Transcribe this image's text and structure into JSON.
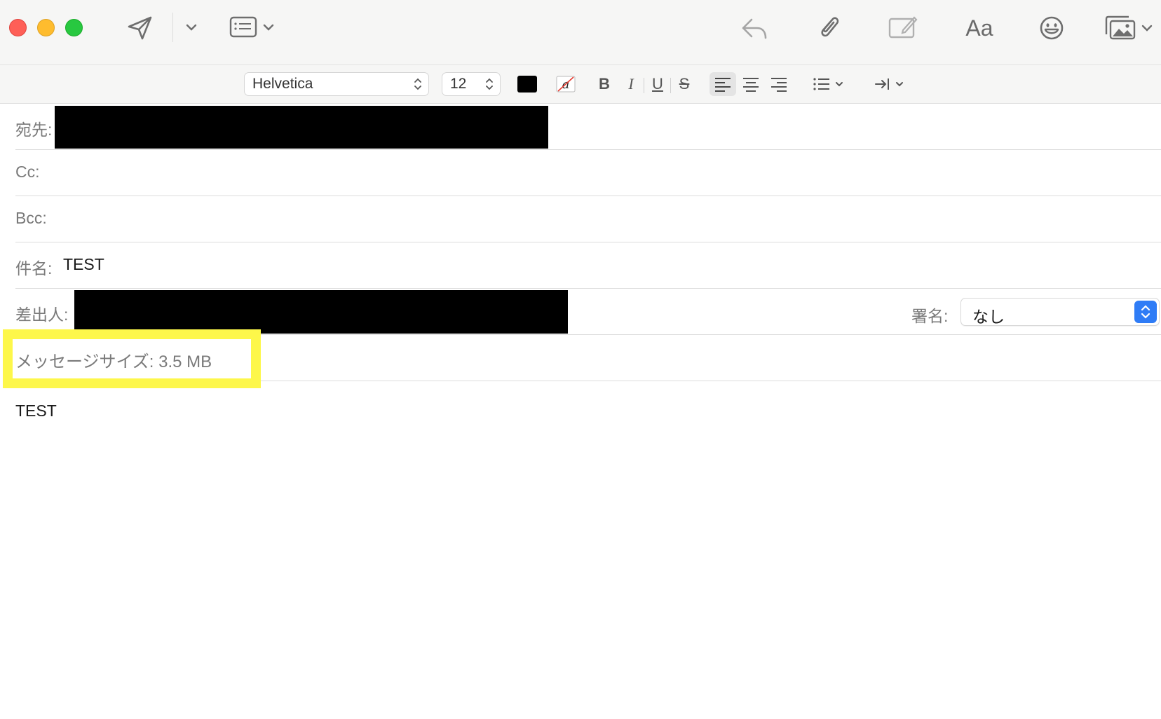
{
  "toolbar": {
    "send_icon": "paper-plane-icon",
    "header_fields_icon": "header-fields-icon",
    "reply_icon": "reply-icon",
    "attach_icon": "paperclip-icon",
    "markup_icon": "markup-icon",
    "format_label": "Aa",
    "emoji_icon": "emoji-icon",
    "photo_icon": "photo-browser-icon"
  },
  "format": {
    "font": "Helvetica",
    "size": "12",
    "text_color": "#000000",
    "bold": "B",
    "italic": "I",
    "underline": "U",
    "strike": "S"
  },
  "fields": {
    "to_label": "宛先:",
    "cc_label": "Cc:",
    "bcc_label": "Bcc:",
    "subject_label": "件名:",
    "subject_value": "TEST",
    "from_label": "差出人:",
    "signature_label": "署名:",
    "signature_value": "なし"
  },
  "message_size": "メッセージサイズ: 3.5 MB",
  "body": {
    "text": "TEST"
  },
  "colors": {
    "highlight": "#fdf74a",
    "accent": "#2f7cf6"
  }
}
